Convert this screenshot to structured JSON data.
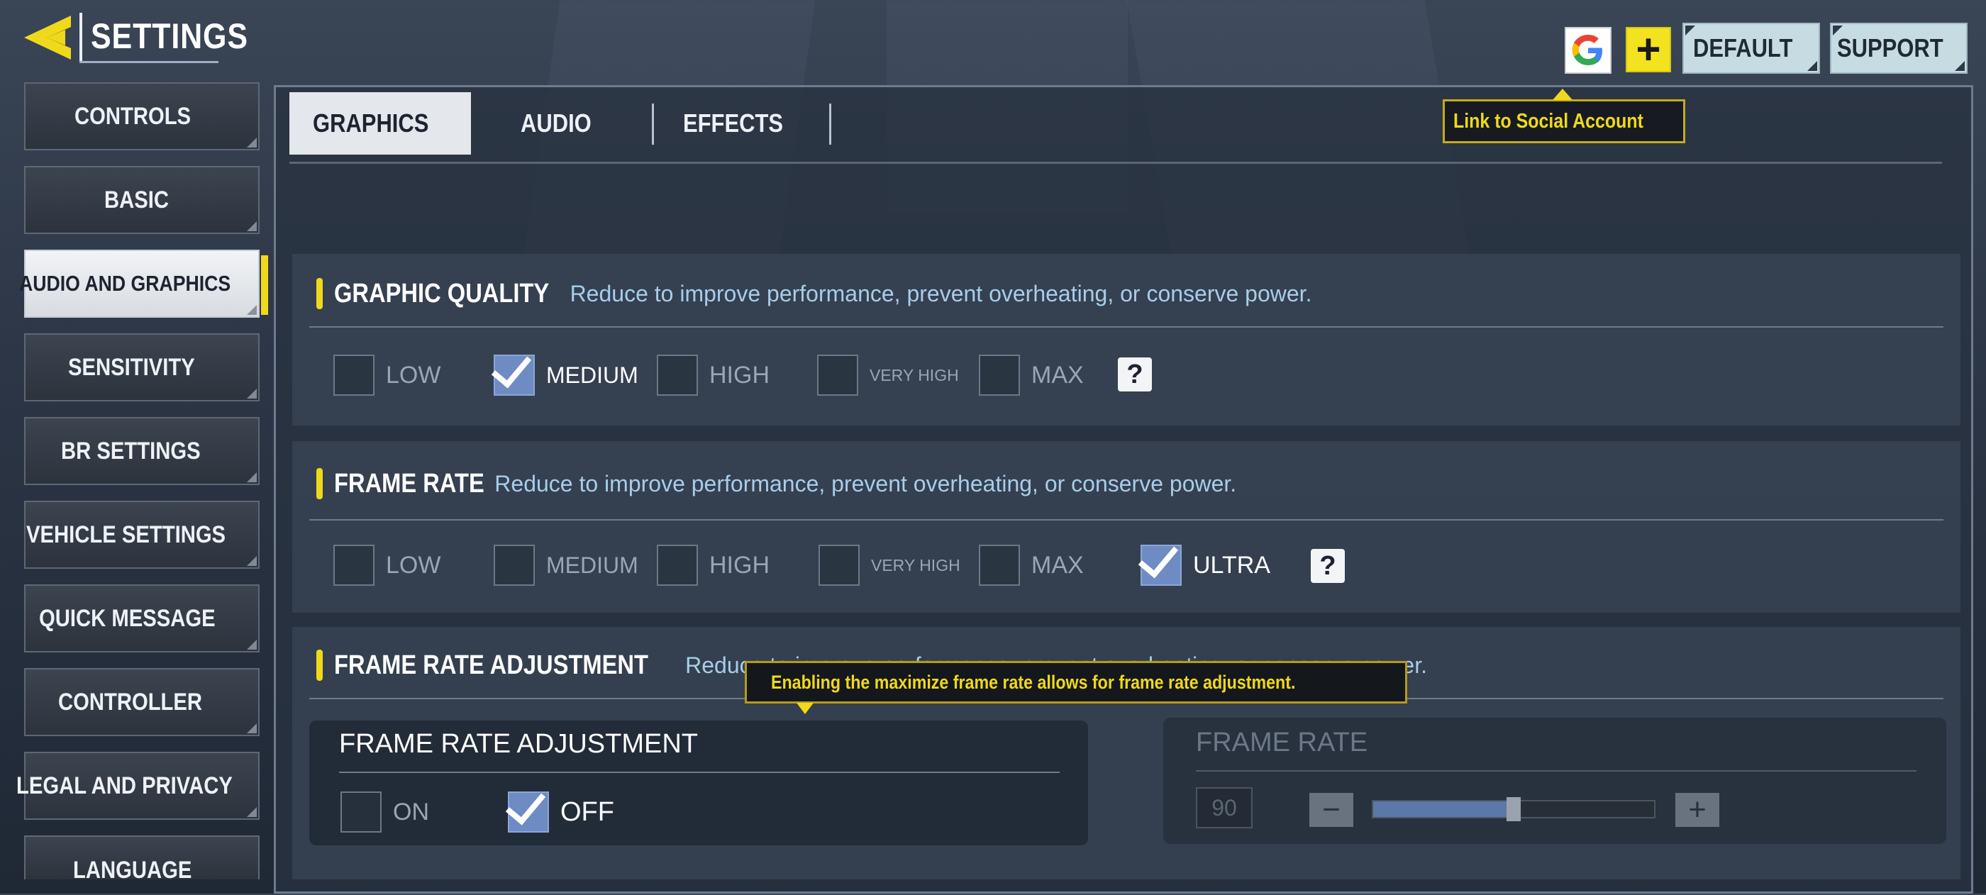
{
  "header": {
    "title": "SETTINGS"
  },
  "sidebar": {
    "items": [
      {
        "label": "CONTROLS",
        "active": false
      },
      {
        "label": "BASIC",
        "active": false
      },
      {
        "label": "AUDIO AND GRAPHICS",
        "active": true
      },
      {
        "label": "SENSITIVITY",
        "active": false
      },
      {
        "label": "BR SETTINGS",
        "active": false
      },
      {
        "label": "VEHICLE SETTINGS",
        "active": false
      },
      {
        "label": "QUICK MESSAGE",
        "active": false
      },
      {
        "label": "CONTROLLER",
        "active": false
      },
      {
        "label": "LEGAL AND PRIVACY",
        "active": false
      },
      {
        "label": "LANGUAGE",
        "active": false
      }
    ]
  },
  "tabs": [
    {
      "label": "GRAPHICS",
      "active": true
    },
    {
      "label": "AUDIO",
      "active": false
    },
    {
      "label": "EFFECTS",
      "active": false
    }
  ],
  "top_buttons": {
    "default": "DEFAULT",
    "support": "SUPPORT",
    "plus": "+",
    "google": "G"
  },
  "tooltips": {
    "social": "Link to Social Account",
    "frame_adjust": "Enabling the maximize frame rate allows for frame rate adjustment."
  },
  "graphic_quality": {
    "title": "GRAPHIC QUALITY",
    "description": "Reduce to improve performance, prevent overheating, or conserve power.",
    "options": [
      "LOW",
      "MEDIUM",
      "HIGH",
      "VERY HIGH",
      "MAX"
    ],
    "selected": "MEDIUM",
    "help": "?"
  },
  "frame_rate": {
    "title": "FRAME RATE",
    "description": "Reduce to improve performance, prevent overheating, or conserve power.",
    "options": [
      "LOW",
      "MEDIUM",
      "HIGH",
      "VERY HIGH",
      "MAX",
      "ULTRA"
    ],
    "selected": "ULTRA",
    "help": "?"
  },
  "frame_rate_adjustment": {
    "title": "FRAME RATE ADJUSTMENT",
    "description": "Reduce to improve performance, prevent overheating, or conserve power.",
    "sub_title": "FRAME RATE ADJUSTMENT",
    "on_label": "ON",
    "off_label": "OFF",
    "selected": "OFF",
    "slider_title": "FRAME RATE",
    "slider_value": "90",
    "slider_fill": 0.5,
    "minus": "−",
    "plus": "+"
  },
  "colors": {
    "accent": "#f0d91a",
    "checked": "#6e8bc4",
    "description": "#a8cdea"
  }
}
